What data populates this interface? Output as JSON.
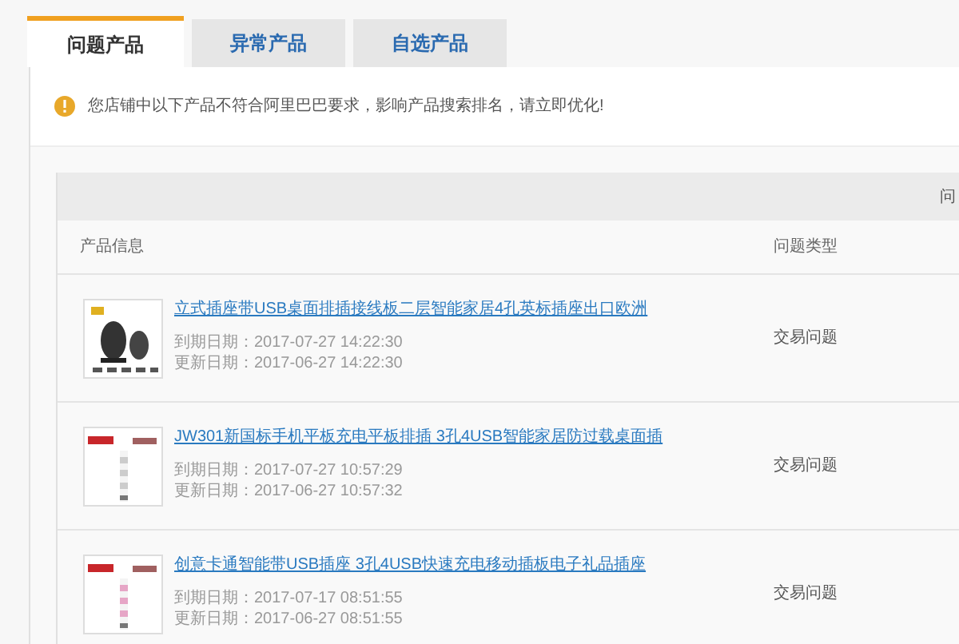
{
  "tabs": [
    {
      "label": "问题产品",
      "selected": true
    },
    {
      "label": "异常产品",
      "selected": false
    },
    {
      "label": "自选产品",
      "selected": false
    }
  ],
  "notice": "您店铺中以下产品不符合阿里巴巴要求，影响产品搜索排名，请立即优化!",
  "table": {
    "top_header": "问",
    "columns": [
      "产品信息",
      "问题类型"
    ],
    "rows": [
      {
        "title": "立式插座带USB桌面排插接线板二层智能家居4孔英标插座出口欧洲",
        "expire": "到期日期：2017-07-27  14:22:30",
        "updated": "更新日期：2017-06-27  14:22:30",
        "issue": "交易问题"
      },
      {
        "title": "JW301新国标手机平板充电平板排插 3孔4USB智能家居防过载桌面插",
        "expire": "到期日期：2017-07-27  10:57:29",
        "updated": "更新日期：2017-06-27  10:57:32",
        "issue": "交易问题"
      },
      {
        "title": "创意卡通智能带USB插座 3孔4USB快速充电移动插板电子礼品插座",
        "expire": "到期日期：2017-07-17  08:51:55",
        "updated": "更新日期：2017-06-27  08:51:55",
        "issue": "交易问题"
      }
    ]
  }
}
